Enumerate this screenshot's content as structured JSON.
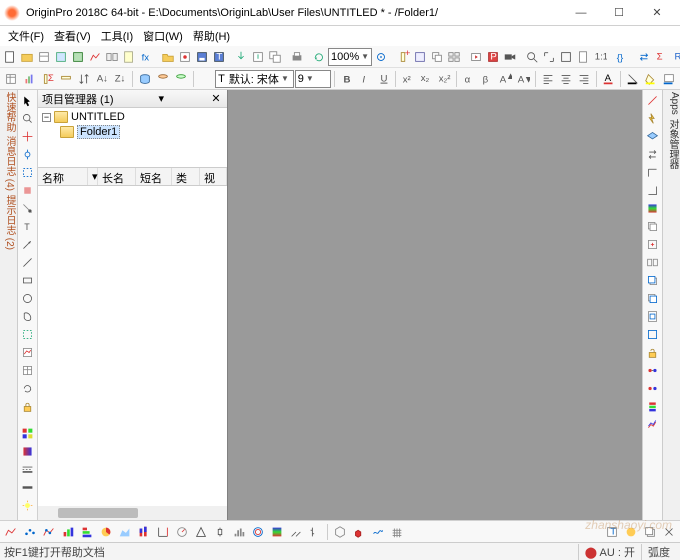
{
  "title": "OriginPro 2018C 64-bit - E:\\Documents\\OriginLab\\User Files\\UNTITLED * - /Folder1/",
  "menu": {
    "file": "文件(F)",
    "view": "查看(V)",
    "tools": "工具(I)",
    "window": "窗口(W)",
    "help": "帮助(H)"
  },
  "zoom": "100%",
  "font_label": "默认: 宋体",
  "font_size": "9",
  "panel": {
    "title": "项目管理器 (1)",
    "root": "UNTITLED",
    "child": "Folder1"
  },
  "cols": {
    "name": "名称",
    "long": "长名称",
    "short": "短名称",
    "type": "类型",
    "view": "视图"
  },
  "vtabs": {
    "quick": "快速帮助",
    "msg": "消息日志 (4)",
    "cmd": "提示日志 (2)"
  },
  "rtabs": {
    "apps": "Apps",
    "obj": "对象管理器"
  },
  "status": {
    "help": "按F1键打开帮助文档",
    "au": "AU : 开",
    "rad": "弧度"
  },
  "watermark": "zhanshaoyi.com"
}
